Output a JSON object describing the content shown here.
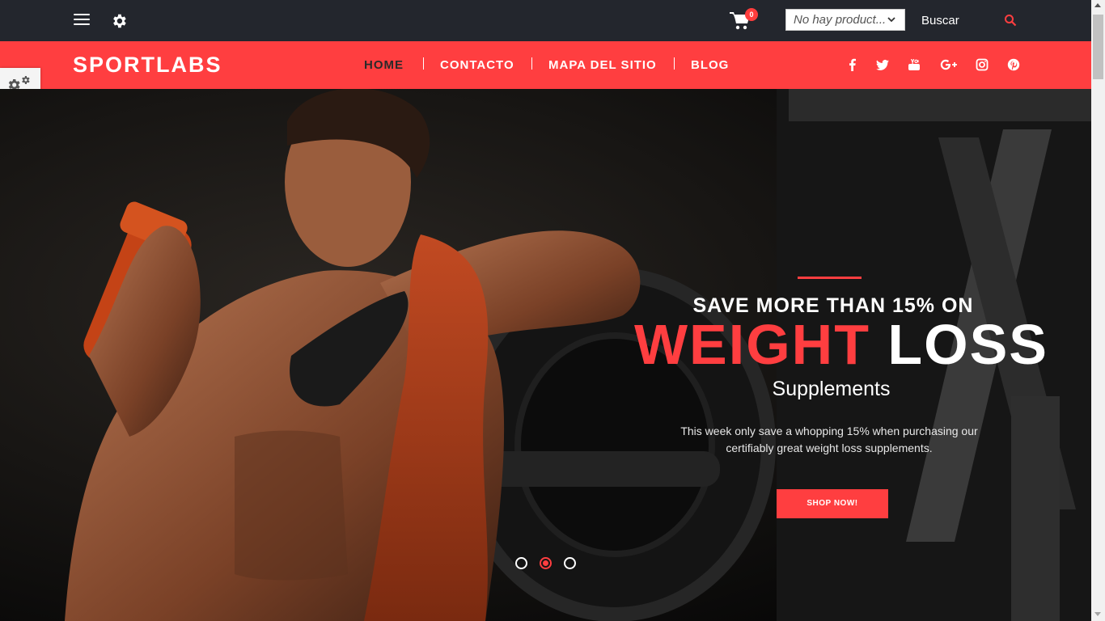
{
  "topbar": {
    "menu_icon": "hamburger-menu-icon",
    "settings_icon": "gear-icon",
    "cart_icon": "shopping-cart-icon",
    "cart_count": "0",
    "product_select_value": "No hay product...",
    "search_label": "Buscar",
    "search_icon": "search-icon"
  },
  "brand": {
    "logo_text": "SPORTLABS",
    "accent_color": "#ff3e40",
    "dark_color": "#23262d"
  },
  "nav": {
    "items": [
      {
        "label": "HOME",
        "active": true
      },
      {
        "label": "CONTACTO",
        "active": false
      },
      {
        "label": "MAPA DEL SITIO",
        "active": false
      },
      {
        "label": "BLOG",
        "active": false
      }
    ]
  },
  "social": [
    "facebook-icon",
    "twitter-icon",
    "youtube-icon",
    "google-plus-icon",
    "instagram-icon",
    "pinterest-icon"
  ],
  "side_tab": {
    "icon": "gears-icon"
  },
  "hero": {
    "headline_top": "SAVE MORE THAN 15% ON",
    "headline_red": "WEIGHT",
    "headline_white": "LOSS",
    "subheadline": "Supplements",
    "description": "This week only save a whopping 15% when purchasing our certifiably great weight loss supplements.",
    "cta_label": "SHOP NOW!",
    "slides_total": 3,
    "active_slide": 2
  }
}
